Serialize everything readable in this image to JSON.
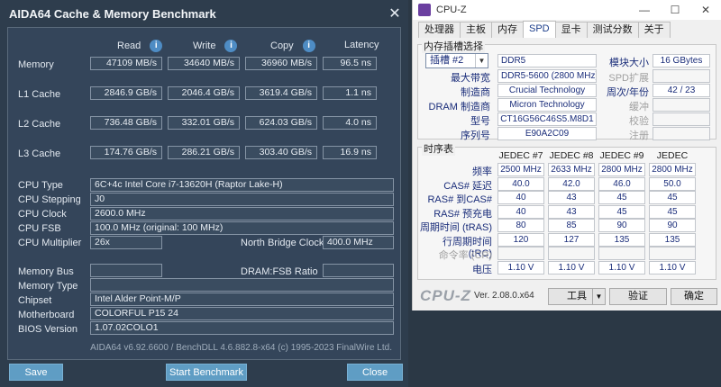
{
  "aida": {
    "title": "AIDA64 Cache & Memory Benchmark",
    "close_glyph": "✕",
    "headers": {
      "read": "Read",
      "write": "Write",
      "copy": "Copy",
      "latency": "Latency"
    },
    "info_glyph": "i",
    "rows": [
      {
        "label": "Memory",
        "read": "47109 MB/s",
        "write": "34640 MB/s",
        "copy": "36960 MB/s",
        "latency": "96.5 ns"
      },
      {
        "label": "L1 Cache",
        "read": "2846.9 GB/s",
        "write": "2046.4 GB/s",
        "copy": "3619.4 GB/s",
        "latency": "1.1 ns"
      },
      {
        "label": "L2 Cache",
        "read": "736.48 GB/s",
        "write": "332.01 GB/s",
        "copy": "624.03 GB/s",
        "latency": "4.0 ns"
      },
      {
        "label": "L3 Cache",
        "read": "174.76 GB/s",
        "write": "286.21 GB/s",
        "copy": "303.40 GB/s",
        "latency": "16.9 ns"
      }
    ],
    "info": {
      "cpu_type_label": "CPU Type",
      "cpu_type": "6C+4c Intel Core i7-13620H  (Raptor Lake-H)",
      "cpu_stepping_label": "CPU Stepping",
      "cpu_stepping": "J0",
      "cpu_clock_label": "CPU Clock",
      "cpu_clock": "2600.0 MHz",
      "cpu_fsb_label": "CPU FSB",
      "cpu_fsb": "100.0 MHz  (original: 100 MHz)",
      "cpu_multiplier_label": "CPU Multiplier",
      "cpu_multiplier": "26x",
      "nb_clock_label": "North Bridge Clock",
      "nb_clock": "400.0 MHz",
      "memory_bus_label": "Memory Bus",
      "memory_bus": "",
      "dram_fsb_label": "DRAM:FSB Ratio",
      "dram_fsb": "",
      "memory_type_label": "Memory Type",
      "memory_type": "",
      "chipset_label": "Chipset",
      "chipset": "Intel Alder Point-M/P",
      "motherboard_label": "Motherboard",
      "motherboard": "COLORFUL P15 24",
      "bios_label": "BIOS Version",
      "bios": "1.07.02COLO1"
    },
    "footer": "AIDA64 v6.92.6600 / BenchDLL 4.6.882.8-x64  (c) 1995-2023 FinalWire Ltd.",
    "buttons": {
      "save": "Save",
      "start": "Start Benchmark",
      "close": "Close"
    }
  },
  "cpuz": {
    "title": "CPU-Z",
    "window_controls": {
      "min": "—",
      "max": "☐",
      "close": "✕"
    },
    "tabs": [
      "处理器",
      "主板",
      "内存",
      "SPD",
      "显卡",
      "测试分数",
      "关于"
    ],
    "active_tab": "SPD",
    "slot_group_title": "内存插槽选择",
    "slot_select": "插槽 #2",
    "slot_arrow": "▼",
    "ddr_type": "DDR5",
    "labels": {
      "max_bw": "最大带宽",
      "manufacturer": "制造商",
      "dram_mfr": "DRAM 制造商",
      "part": "型号",
      "serial": "序列号",
      "module_size": "模块大小",
      "spd_ext": "SPD扩展",
      "week_year": "周次/年份",
      "buffered": "缓冲",
      "correction": "校验",
      "registered": "注册"
    },
    "values": {
      "max_bw": "DDR5-5600 (2800 MHz)",
      "manufacturer": "Crucial Technology",
      "dram_mfr": "Micron Technology",
      "part": "CT16G56C46S5.M8D1",
      "serial": "E90A2C09",
      "module_size": "16 GBytes",
      "spd_ext": "",
      "week_year": "42 / 23",
      "buffered": "",
      "correction": "",
      "registered": ""
    },
    "timing_group_title": "时序表",
    "jedec_headers": [
      "JEDEC #7",
      "JEDEC #8",
      "JEDEC #9",
      "JEDEC #10"
    ],
    "timing_rows": [
      {
        "label": "频率",
        "values": [
          "2500 MHz",
          "2633 MHz",
          "2800 MHz",
          "2800 MHz"
        ]
      },
      {
        "label": "CAS# 延迟",
        "values": [
          "40.0",
          "42.0",
          "46.0",
          "50.0"
        ]
      },
      {
        "label": "RAS# 到CAS#",
        "values": [
          "40",
          "43",
          "45",
          "45"
        ]
      },
      {
        "label": "RAS# 预充电",
        "values": [
          "40",
          "43",
          "45",
          "45"
        ]
      },
      {
        "label": "周期时间 (tRAS)",
        "values": [
          "80",
          "85",
          "90",
          "90"
        ]
      },
      {
        "label": "行周期时间 (tRC)",
        "values": [
          "120",
          "127",
          "135",
          "135"
        ]
      },
      {
        "label": "命令率 (CR)",
        "values": [
          "",
          "",
          "",
          ""
        ]
      },
      {
        "label": "电压",
        "values": [
          "1.10 V",
          "1.10 V",
          "1.10 V",
          "1.10 V"
        ]
      }
    ],
    "logo": "CPU-Z",
    "version": "Ver. 2.08.0.x64",
    "buttons": {
      "tools": "工具",
      "tools_arrow": "▼",
      "validate": "验证",
      "ok": "确定"
    }
  }
}
